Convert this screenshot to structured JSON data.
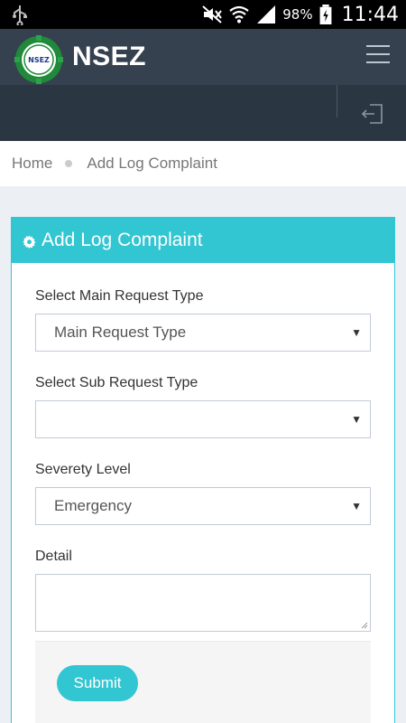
{
  "status_bar": {
    "battery_percent": "98%",
    "time": "11:44",
    "icons": [
      "usb-icon",
      "mute-icon",
      "wifi-icon",
      "signal-icon",
      "battery-charging-icon"
    ]
  },
  "header": {
    "brand": "NSEZ",
    "logo_text": "NSEZ",
    "menu_icon": "hamburger-menu-icon",
    "logout_icon": "logout-icon"
  },
  "breadcrumb": {
    "home": "Home",
    "current": "Add Log Complaint"
  },
  "form": {
    "title": "Add Log Complaint",
    "title_icon": "gear-icon",
    "main_request": {
      "label": "Select Main Request Type",
      "value": "Main Request Type"
    },
    "sub_request": {
      "label": "Select Sub Request Type",
      "value": ""
    },
    "severity": {
      "label": "Severety Level",
      "value": "Emergency"
    },
    "detail": {
      "label": "Detail",
      "value": ""
    },
    "submit_label": "Submit"
  },
  "colors": {
    "accent": "#32c5d2",
    "header_bg": "#364150",
    "subbar_bg": "#2b3643"
  }
}
